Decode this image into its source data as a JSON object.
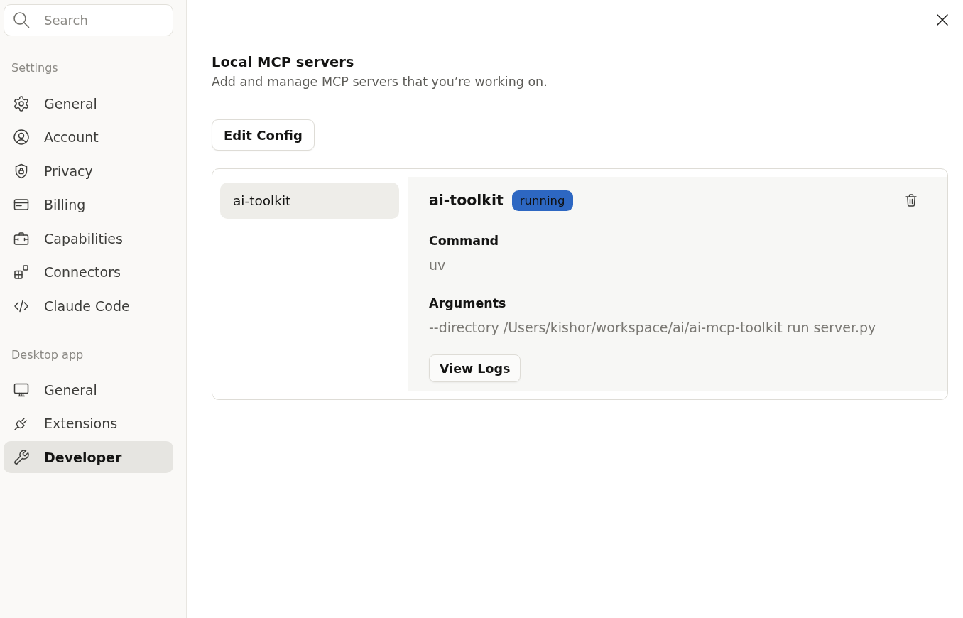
{
  "sidebar": {
    "search": {
      "placeholder": "Search"
    },
    "sections": [
      {
        "title": "Settings",
        "items": [
          {
            "label": "General",
            "selected": false
          },
          {
            "label": "Account",
            "selected": false
          },
          {
            "label": "Privacy",
            "selected": false
          },
          {
            "label": "Billing",
            "selected": false
          },
          {
            "label": "Capabilities",
            "selected": false
          },
          {
            "label": "Connectors",
            "selected": false
          },
          {
            "label": "Claude Code",
            "selected": false
          }
        ]
      },
      {
        "title": "Desktop app",
        "items": [
          {
            "label": "General",
            "selected": false
          },
          {
            "label": "Extensions",
            "selected": false
          },
          {
            "label": "Developer",
            "selected": true
          }
        ]
      }
    ]
  },
  "page": {
    "title": "Local MCP servers",
    "description": "Add and manage MCP servers that you’re working on.",
    "edit_button": "Edit Config"
  },
  "servers": {
    "list": [
      {
        "name": "ai-toolkit",
        "selected": true
      }
    ],
    "detail": {
      "name": "ai-toolkit",
      "status": "running",
      "fields": [
        {
          "label": "Command",
          "value": "uv"
        },
        {
          "label": "Arguments",
          "value": "--directory /Users/kishor/workspace/ai/ai-mcp-toolkit run server.py"
        }
      ],
      "logs_button": "View Logs"
    }
  }
}
